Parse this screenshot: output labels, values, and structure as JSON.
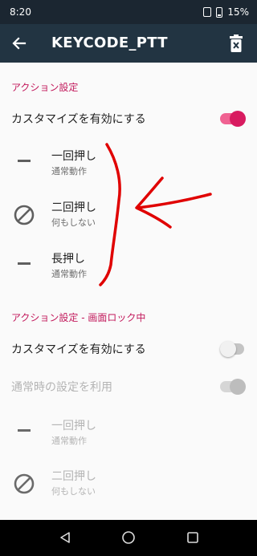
{
  "status_bar": {
    "time": "8:20",
    "battery_percent": "15%",
    "vibrate_icon": "vibrate-icon",
    "battery_icon": "battery-icon"
  },
  "app_bar": {
    "title": "KEYCODE_PTT",
    "back_icon": "arrow-back-icon",
    "delete_icon": "delete-icon"
  },
  "section1": {
    "header": "アクション設定",
    "customize_label": "カスタマイズを有効にする",
    "customize_enabled": true,
    "actions": [
      {
        "title": "一回押し",
        "subtitle": "通常動作",
        "icon": "dash-icon"
      },
      {
        "title": "二回押し",
        "subtitle": "何もしない",
        "icon": "block-icon"
      },
      {
        "title": "長押し",
        "subtitle": "通常動作",
        "icon": "dash-icon"
      }
    ]
  },
  "section2": {
    "header": "アクション設定 - 画面ロック中",
    "customize_label": "カスタマイズを有効にする",
    "customize_enabled": false,
    "use_normal_label": "通常時の設定を利用",
    "use_normal_enabled": true,
    "actions": [
      {
        "title": "一回押し",
        "subtitle": "通常動作",
        "icon": "dash-icon"
      },
      {
        "title": "二回押し",
        "subtitle": "何もしない",
        "icon": "block-icon"
      }
    ]
  },
  "colors": {
    "accent": "#d81b60",
    "header_text": "#c2185b",
    "app_bar": "#223442",
    "status_bar": "#1b2631",
    "annotation": "#e00000"
  },
  "nav_bar": {
    "back_icon": "nav-back-icon",
    "home_icon": "nav-home-icon",
    "recents_icon": "nav-recents-icon"
  }
}
